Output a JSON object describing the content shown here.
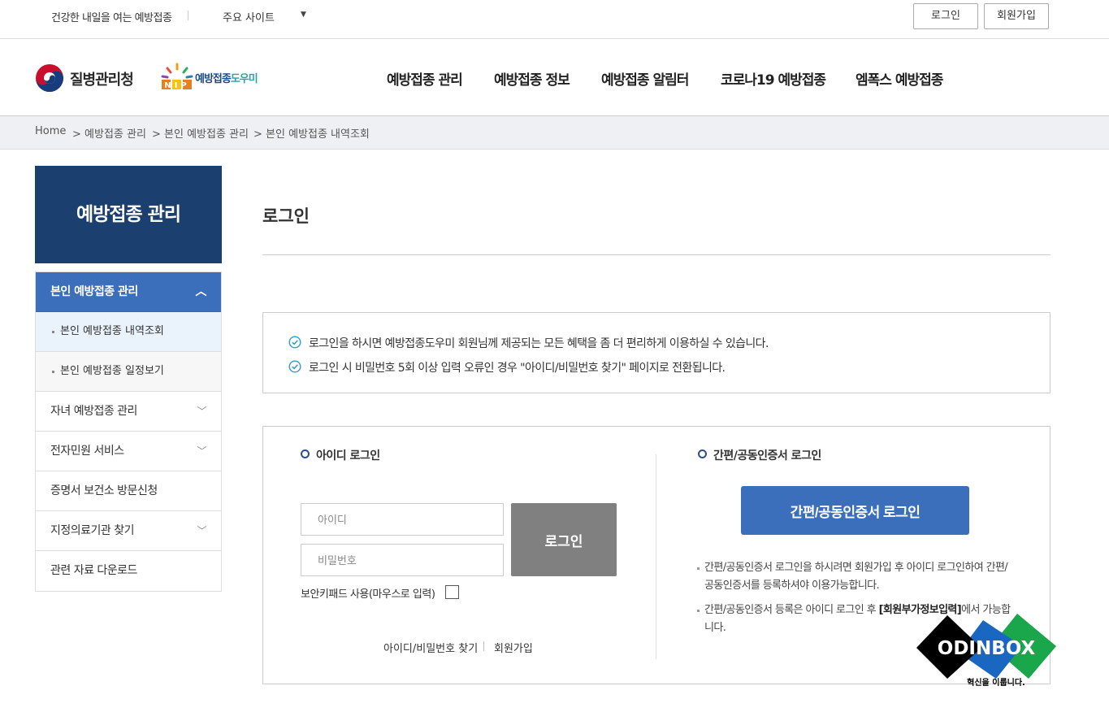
{
  "topbar": {
    "tagline": "건강한 내일을 여는 예방접종",
    "sites_label": "주요 사이트",
    "login_label": "로그인",
    "signup_label": "회원가입"
  },
  "header": {
    "org_name": "질병관리청",
    "brand_name_a": "예방접종",
    "brand_name_b": "도우미",
    "brand_logo_text": "NIP",
    "nav": [
      "예방접종 관리",
      "예방접종 정보",
      "예방접종 알림터",
      "코로나19 예방접종",
      "엠폭스 예방접종"
    ]
  },
  "breadcrumb": [
    "Home",
    "> 예방접종 관리",
    "> 본인 예방접종 관리",
    "> 본인 예방접종 내역조회"
  ],
  "sidebar": {
    "title": "예방접종 관리",
    "active_item": "본인 예방접종 관리",
    "sub_items": [
      "본인 예방접종 내역조회",
      "본인 예방접종 일정보기"
    ],
    "items": [
      "자녀 예방접종 관리",
      "전자민원 서비스",
      "증명서 보건소 방문신청",
      "지정의료기관 찾기",
      "관련 자료 다운로드"
    ]
  },
  "main": {
    "title": "로그인",
    "notices": [
      "로그인을 하시면 예방접종도우미 회원님께 제공되는 모든 혜택을 좀 더 편리하게 이용하실 수 있습니다.",
      "로그인 시 비밀번호 5회 이상 입력 오류인 경우 \"아이디/비밀번호 찾기\" 페이지로 전환됩니다."
    ],
    "id_login": {
      "title": "아이디 로그인",
      "id_placeholder": "아이디",
      "pw_placeholder": "비밀번호",
      "login_button": "로그인",
      "keypad_label": "보안키패드 사용(마우스로 입력)",
      "find_link": "아이디/비밀번호 찾기",
      "signup_link": "회원가입"
    },
    "cert_login": {
      "title": "간편/공동인증서 로그인",
      "button": "간편/공동인증서 로그인",
      "note1_line1": "간편/공동인증서 로그인을 하시려면 회원가입 후 아이디 로그인하여 간편/",
      "note1_line2": "공동인증서를 등록하셔야 이용가능합니다.",
      "note2_pre": "간편/공동인증서 등록은 아이디 로그인 후 ",
      "note2_bold": "[회원부가정보입력]",
      "note2_post": "에서 가능합",
      "note2_line2": "니다."
    }
  },
  "watermark": {
    "brand": "ODINBOX",
    "slogan": "혁신을 이룹니다."
  },
  "colors": {
    "navy": "#1b3f6e",
    "accent_blue": "#3c6fbb",
    "button_gray": "#808080"
  }
}
